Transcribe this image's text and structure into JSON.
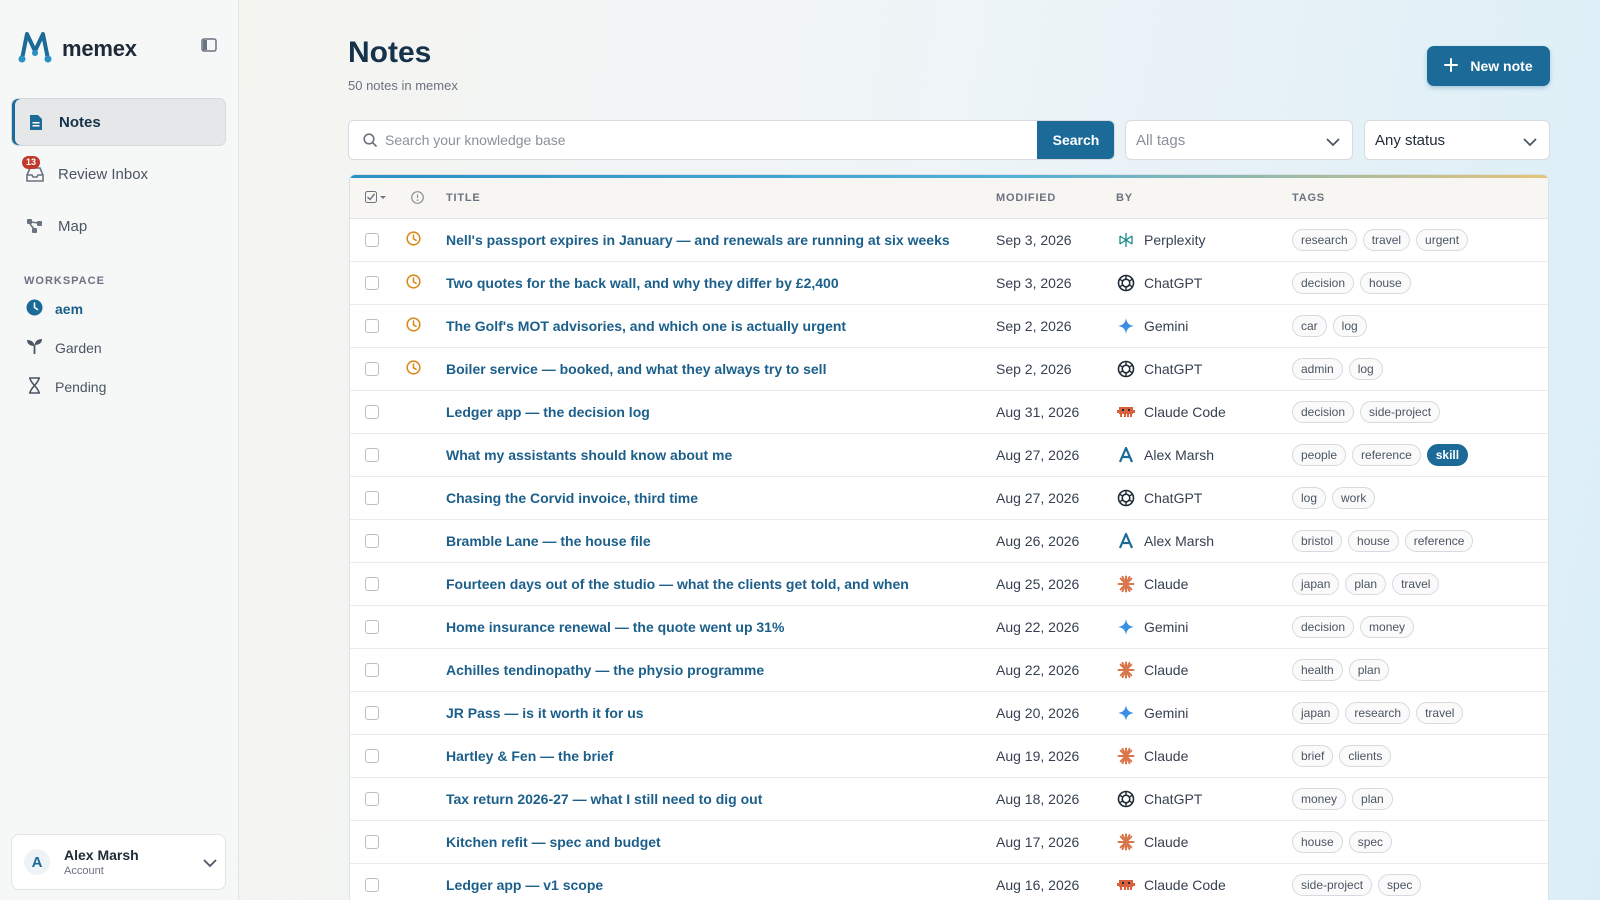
{
  "app": {
    "name": "memex"
  },
  "sidebar": {
    "nav": [
      {
        "label": "Notes",
        "icon": "document-icon",
        "active": true
      },
      {
        "label": "Review Inbox",
        "icon": "inbox-icon",
        "badge": "13"
      },
      {
        "label": "Map",
        "icon": "map-icon"
      }
    ],
    "section_label": "WORKSPACE",
    "workspace": [
      {
        "label": "aem",
        "icon": "clock-icon",
        "active": true
      },
      {
        "label": "Garden",
        "icon": "sprout-icon"
      },
      {
        "label": "Pending",
        "icon": "hourglass-icon"
      }
    ],
    "account": {
      "initial": "A",
      "name": "Alex Marsh",
      "sub": "Account"
    }
  },
  "header": {
    "title": "Notes",
    "subtitle": "50 notes in memex",
    "new_button": "New note"
  },
  "search": {
    "placeholder": "Search your knowledge base",
    "button": "Search",
    "tags_filter": "All tags",
    "status_filter": "Any status"
  },
  "table": {
    "columns": {
      "title": "TITLE",
      "modified": "MODIFIED",
      "by": "BY",
      "tags": "TAGS"
    },
    "rows": [
      {
        "title": "Nell's passport expires in January — and renewals are running at six weeks",
        "modified": "Sep 3, 2026",
        "by": "Perplexity",
        "by_icon": "perplexity-icon",
        "pending": true,
        "tags": [
          "research",
          "travel",
          "urgent"
        ]
      },
      {
        "title": "Two quotes for the back wall, and why they differ by £2,400",
        "modified": "Sep 3, 2026",
        "by": "ChatGPT",
        "by_icon": "chatgpt-icon",
        "pending": true,
        "tags": [
          "decision",
          "house"
        ]
      },
      {
        "title": "The Golf's MOT advisories, and which one is actually urgent",
        "modified": "Sep 2, 2026",
        "by": "Gemini",
        "by_icon": "gemini-icon",
        "pending": true,
        "tags": [
          "car",
          "log"
        ]
      },
      {
        "title": "Boiler service — booked, and what they always try to sell",
        "modified": "Sep 2, 2026",
        "by": "ChatGPT",
        "by_icon": "chatgpt-icon",
        "pending": true,
        "tags": [
          "admin",
          "log"
        ]
      },
      {
        "title": "Ledger app — the decision log",
        "modified": "Aug 31, 2026",
        "by": "Claude Code",
        "by_icon": "claude-code-icon",
        "pending": false,
        "tags": [
          "decision",
          "side-project"
        ]
      },
      {
        "title": "What my assistants should know about me",
        "modified": "Aug 27, 2026",
        "by": "Alex Marsh",
        "by_icon": "user-initial-icon",
        "pending": false,
        "tags": [
          "people",
          "reference",
          "skill"
        ]
      },
      {
        "title": "Chasing the Corvid invoice, third time",
        "modified": "Aug 27, 2026",
        "by": "ChatGPT",
        "by_icon": "chatgpt-icon",
        "pending": false,
        "tags": [
          "log",
          "work"
        ]
      },
      {
        "title": "Bramble Lane — the house file",
        "modified": "Aug 26, 2026",
        "by": "Alex Marsh",
        "by_icon": "user-initial-icon",
        "pending": false,
        "tags": [
          "bristol",
          "house",
          "reference"
        ]
      },
      {
        "title": "Fourteen days out of the studio — what the clients get told, and when",
        "modified": "Aug 25, 2026",
        "by": "Claude",
        "by_icon": "claude-icon",
        "pending": false,
        "tags": [
          "japan",
          "plan",
          "travel"
        ]
      },
      {
        "title": "Home insurance renewal — the quote went up 31%",
        "modified": "Aug 22, 2026",
        "by": "Gemini",
        "by_icon": "gemini-icon",
        "pending": false,
        "tags": [
          "decision",
          "money"
        ]
      },
      {
        "title": "Achilles tendinopathy — the physio programme",
        "modified": "Aug 22, 2026",
        "by": "Claude",
        "by_icon": "claude-icon",
        "pending": false,
        "tags": [
          "health",
          "plan"
        ]
      },
      {
        "title": "JR Pass — is it worth it for us",
        "modified": "Aug 20, 2026",
        "by": "Gemini",
        "by_icon": "gemini-icon",
        "pending": false,
        "tags": [
          "japan",
          "research",
          "travel"
        ]
      },
      {
        "title": "Hartley & Fen — the brief",
        "modified": "Aug 19, 2026",
        "by": "Claude",
        "by_icon": "claude-icon",
        "pending": false,
        "tags": [
          "brief",
          "clients"
        ]
      },
      {
        "title": "Tax return 2026-27 — what I still need to dig out",
        "modified": "Aug 18, 2026",
        "by": "ChatGPT",
        "by_icon": "chatgpt-icon",
        "pending": false,
        "tags": [
          "money",
          "plan"
        ]
      },
      {
        "title": "Kitchen refit — spec and budget",
        "modified": "Aug 17, 2026",
        "by": "Claude",
        "by_icon": "claude-icon",
        "pending": false,
        "tags": [
          "house",
          "spec"
        ]
      },
      {
        "title": "Ledger app — v1 scope",
        "modified": "Aug 16, 2026",
        "by": "Claude Code",
        "by_icon": "claude-code-icon",
        "pending": false,
        "tags": [
          "side-project",
          "spec"
        ]
      }
    ],
    "highlighted_tag": "skill"
  },
  "colors": {
    "accent": "#1b6a97",
    "badge": "#c0392b",
    "pending": "#d98c1e",
    "link": "#1b5f8a"
  }
}
